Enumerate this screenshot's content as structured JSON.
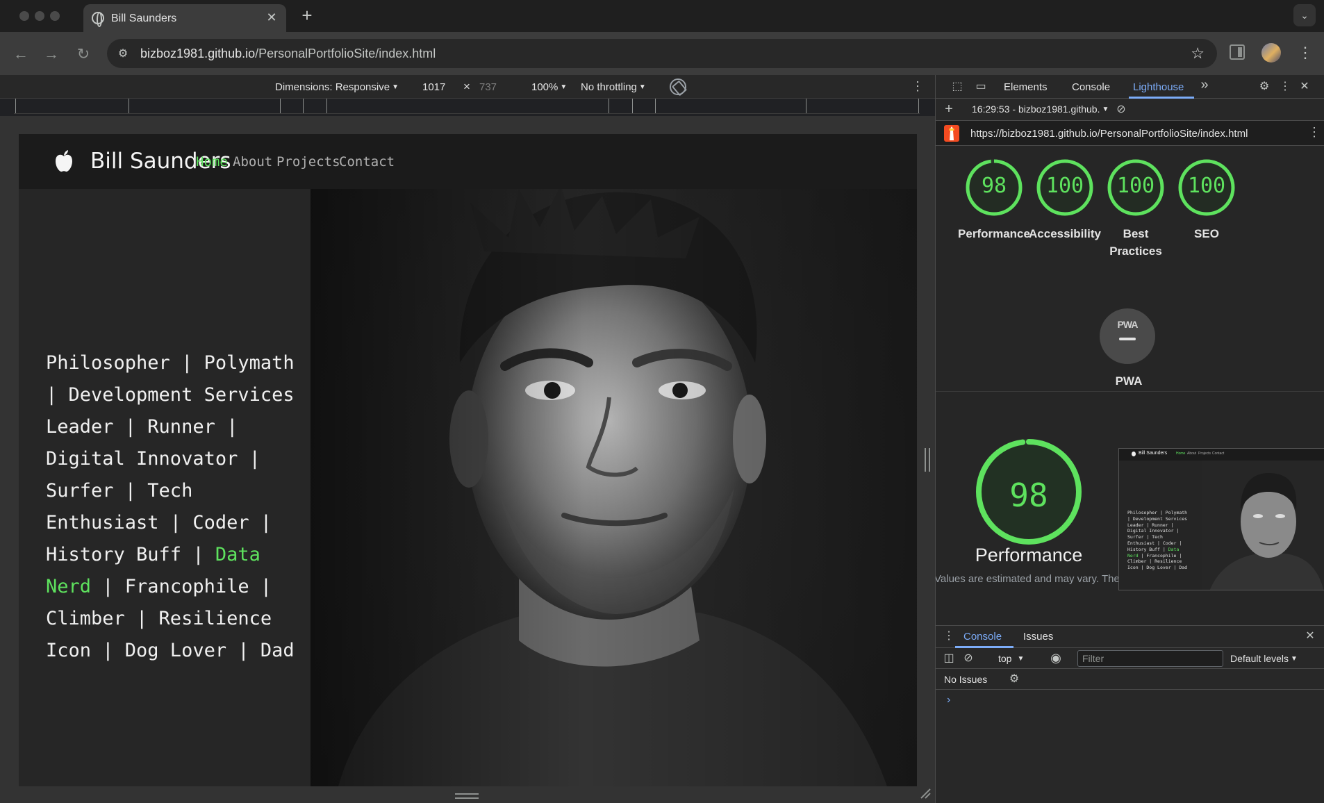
{
  "browser": {
    "tab_title": "Bill Saunders",
    "tab_close": "✕",
    "new_tab": "+",
    "url_host": "bizboz1981.github.io",
    "url_path": "/PersonalPortfolioSite/index.html"
  },
  "device_toolbar": {
    "dimensions_label": "Dimensions: Responsive",
    "width": "1017",
    "times": "×",
    "height": "737",
    "zoom": "100%",
    "throttling": "No throttling"
  },
  "page": {
    "brand": "Bill Saunders",
    "nav": [
      "Home",
      "About",
      "Projects",
      "Contact"
    ],
    "active_nav": "Home",
    "accent_color": "#5ee25e",
    "tagline_lines": [
      "Philosopher | Polymath",
      "| Development Services",
      "Leader | Runner |",
      "Digital Innovator |",
      "Surfer | Tech",
      "Enthusiast | Coder |"
    ],
    "tagline_line7": "History Buff | ",
    "tagline_line7_highlight": "Data",
    "tagline_line8_highlight": "Nerd",
    "tagline_line8": " | Francophile |",
    "tagline_line9": "Climber | Resilience",
    "tagline_line10": "Icon | Dog Lover | Dad"
  },
  "devtools": {
    "tabs": [
      "Elements",
      "Console",
      "Lighthouse"
    ],
    "active_tab": "Lighthouse",
    "more_tabs": "»",
    "report_selector": "16:29:53 - bizboz1981.github.",
    "report_url": "https://bizboz1981.github.io/PersonalPortfolioSite/index.html",
    "scores": [
      {
        "label": "Performance",
        "value": "98",
        "score": 0.98
      },
      {
        "label": "Accessibility",
        "value": "100",
        "score": 1.0
      },
      {
        "label": "Best Practices",
        "value": "100",
        "score": 1.0
      },
      {
        "label": "SEO",
        "value": "100",
        "score": 1.0
      }
    ],
    "pwa_badge": "PWA",
    "pwa_label": "PWA",
    "big_score": {
      "label": "Performance",
      "value": "98",
      "score": 0.98
    },
    "note": "Values are estimated and may vary. The",
    "score_color": "#5ee25e",
    "drawer": {
      "tabs": [
        "Console",
        "Issues"
      ],
      "active_tab": "Console",
      "context": "top",
      "filter_placeholder": "Filter",
      "levels": "Default levels",
      "no_issues": "No Issues",
      "prompt": "›"
    }
  }
}
